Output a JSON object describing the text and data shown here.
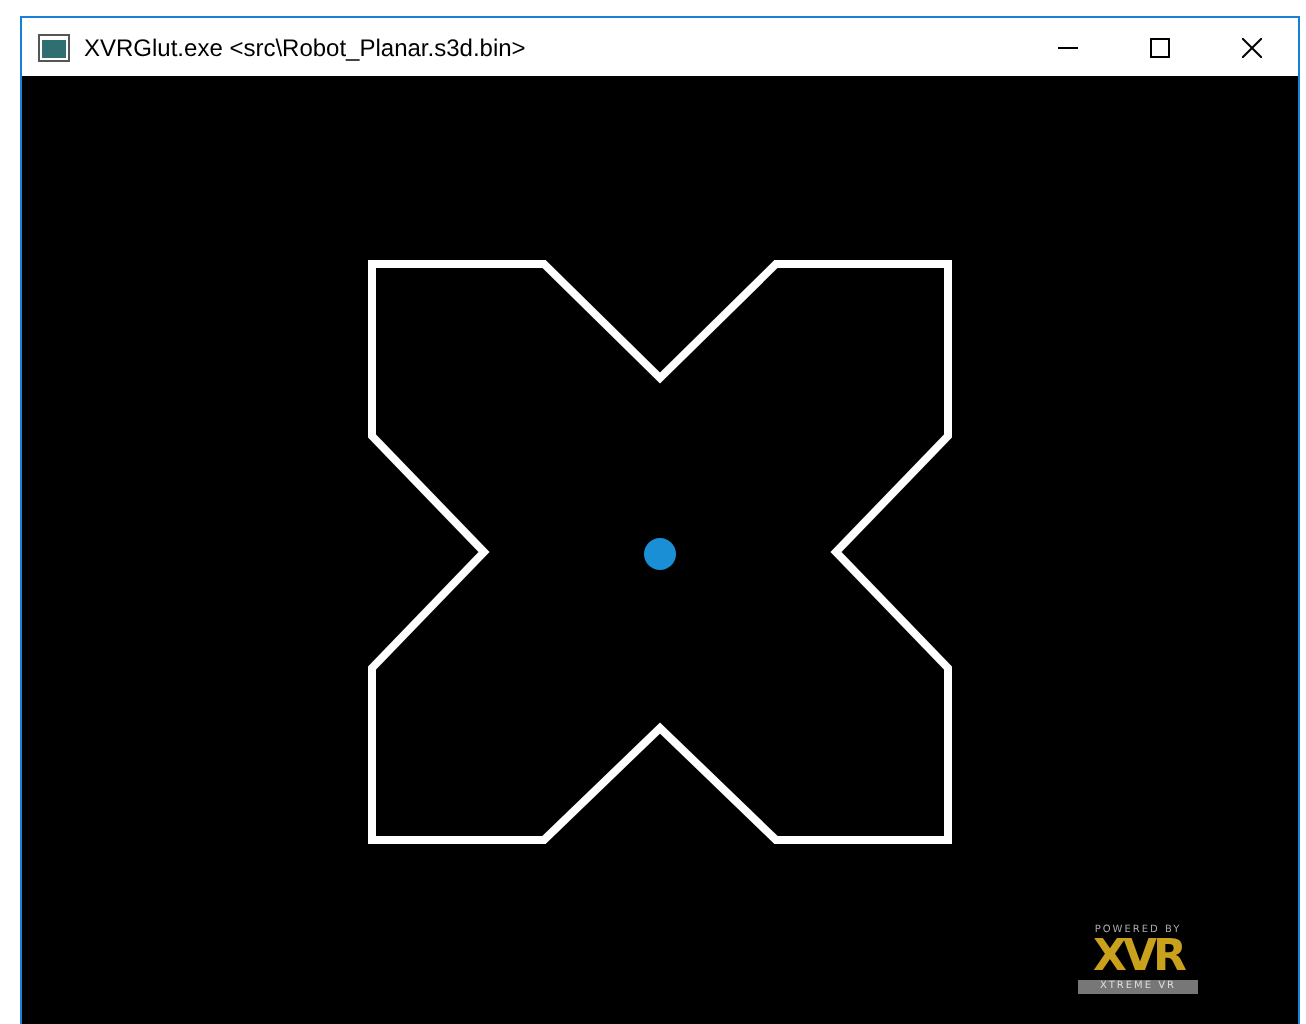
{
  "window": {
    "title": "XVRGlut.exe <src\\Robot_Planar.s3d.bin>"
  },
  "logo": {
    "tagline": "POWERED BY",
    "mark": "XVR",
    "subtitle": "XTREME VR"
  }
}
